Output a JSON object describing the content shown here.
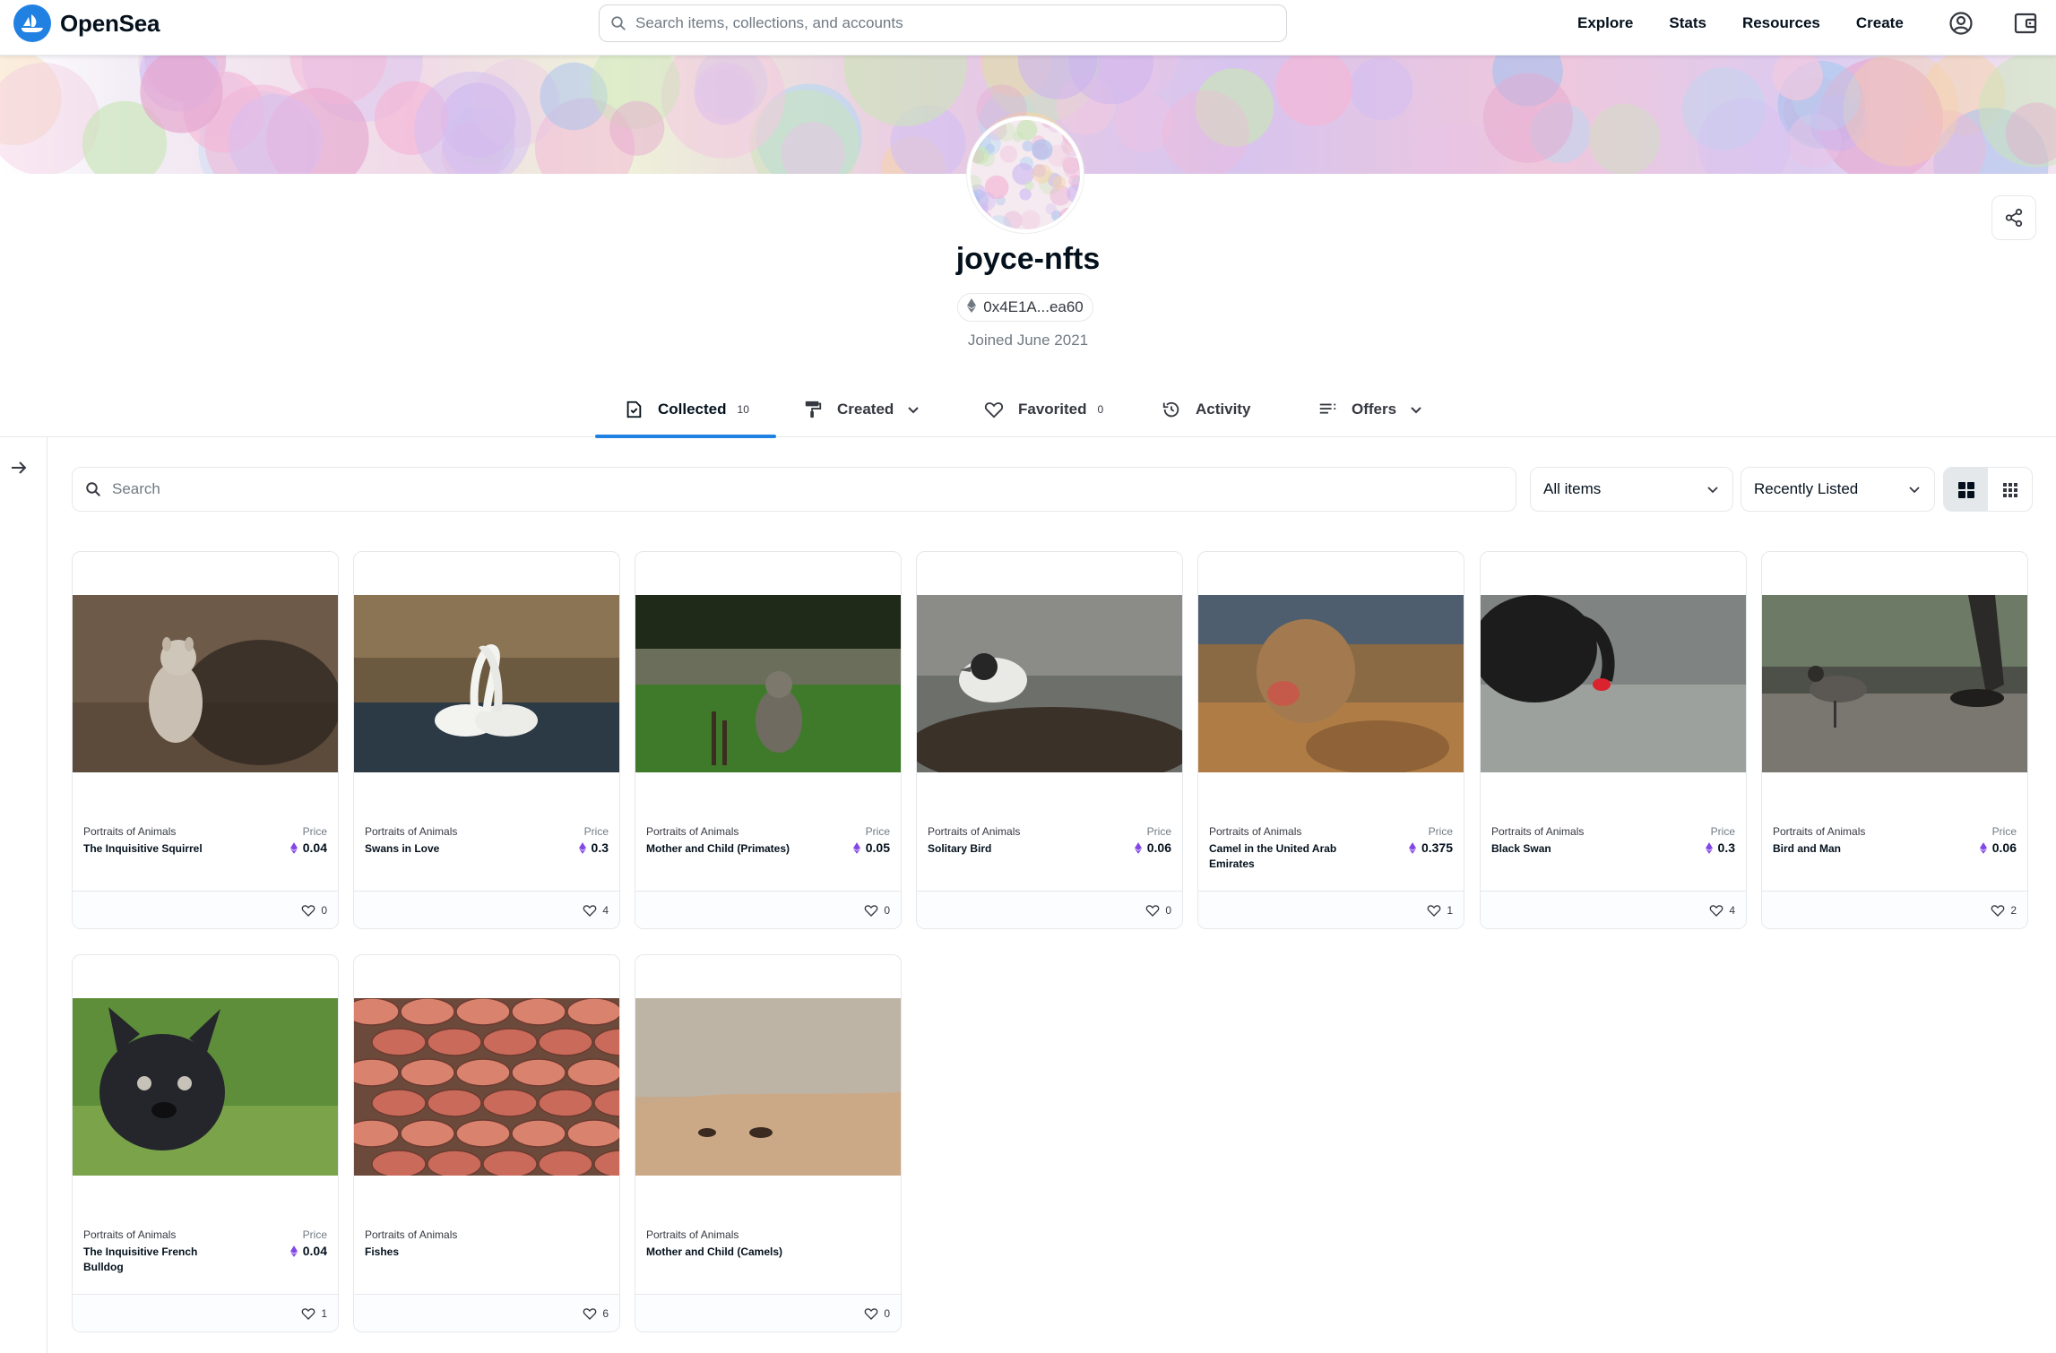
{
  "nav": {
    "brand": "OpenSea",
    "search_placeholder": "Search items, collections, and accounts",
    "links": [
      "Explore",
      "Stats",
      "Resources",
      "Create"
    ]
  },
  "profile": {
    "username": "joyce-nfts",
    "address": "0x4E1A...ea60",
    "joined": "Joined June 2021"
  },
  "tabs": [
    {
      "label": "Collected",
      "count": "10",
      "active": true
    },
    {
      "label": "Created"
    },
    {
      "label": "Favorited",
      "count": "0"
    },
    {
      "label": "Activity"
    },
    {
      "label": "Offers"
    }
  ],
  "filters": {
    "search_placeholder": "Search",
    "items_select": "All items",
    "sort_select": "Recently Listed"
  },
  "colors": {
    "accent": "#2081e2",
    "text": "#04111d",
    "muted": "#707a83",
    "border": "#e5e8eb",
    "eth": "#8247e5"
  },
  "cards": [
    {
      "collection": "Portraits of Animals",
      "name": "The Inquisitive Squirrel",
      "price_label": "Price",
      "price": "0.04",
      "likes": "0",
      "image": "squirrel"
    },
    {
      "collection": "Portraits of Animals",
      "name": "Swans in Love",
      "price_label": "Price",
      "price": "0.3",
      "likes": "4",
      "image": "swans"
    },
    {
      "collection": "Portraits of Animals",
      "name": "Mother and Child (Primates)",
      "price_label": "Price",
      "price": "0.05",
      "likes": "0",
      "image": "monkeys"
    },
    {
      "collection": "Portraits of Animals",
      "name": "Solitary Bird",
      "price_label": "Price",
      "price": "0.06",
      "likes": "0",
      "image": "bird"
    },
    {
      "collection": "Portraits of Animals",
      "name": "Camel in the United Arab Emirates",
      "price_label": "Price",
      "price": "0.375",
      "likes": "1",
      "image": "camel"
    },
    {
      "collection": "Portraits of Animals",
      "name": "Black Swan",
      "price_label": "Price",
      "price": "0.3",
      "likes": "4",
      "image": "blackswan"
    },
    {
      "collection": "Portraits of Animals",
      "name": "Bird and Man",
      "price_label": "Price",
      "price": "0.06",
      "likes": "2",
      "image": "birdman"
    },
    {
      "collection": "Portraits of Animals",
      "name": "The Inquisitive French Bulldog",
      "price_label": "Price",
      "price": "0.04",
      "likes": "1",
      "image": "bulldog"
    },
    {
      "collection": "Portraits of Animals",
      "name": "Fishes",
      "price_label": "",
      "price": "",
      "likes": "6",
      "image": "fishes"
    },
    {
      "collection": "Portraits of Animals",
      "name": "Mother and Child (Camels)",
      "price_label": "",
      "price": "",
      "likes": "0",
      "image": "camels"
    }
  ]
}
